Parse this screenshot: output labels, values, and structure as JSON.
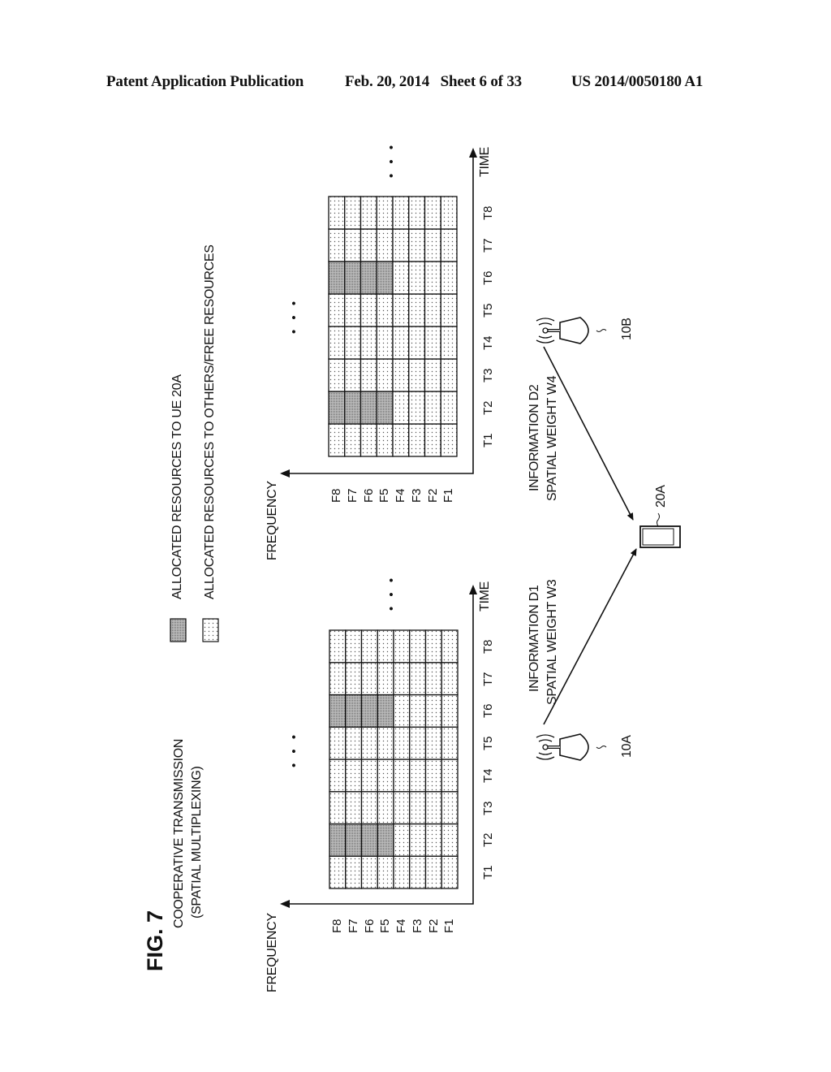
{
  "header": {
    "publication": "Patent Application Publication",
    "date_sheet": "Feb. 20, 2014   Sheet 6 of 33",
    "number": "US 2014/0050180 A1"
  },
  "figure": {
    "label": "FIG. 7",
    "title_line1": "COOPERATIVE TRANSMISSION",
    "title_line2": "(SPATIAL MULTIPLEXING)",
    "legend": [
      {
        "label": "ALLOCATED RESOURCES TO UE 20A",
        "pattern": "dense-shaded"
      },
      {
        "label": "ALLOCATED RESOURCES TO OTHERS/FREE RESOURCES",
        "pattern": "sparse-dotted"
      }
    ],
    "grids": [
      {
        "name": "grid-base-station-10A",
        "x_axis_label": "TIME",
        "y_axis_label": "FREQUENCY",
        "time_labels": [
          "T1",
          "T2",
          "T3",
          "T4",
          "T5",
          "T6",
          "T7",
          "T8"
        ],
        "freq_labels": [
          "F8",
          "F7",
          "F6",
          "F5",
          "F4",
          "F3",
          "F2",
          "F1"
        ],
        "allocated_to_ue": [
          {
            "time": "T2",
            "freqs": [
              "F8",
              "F7",
              "F6",
              "F5"
            ]
          },
          {
            "time": "T6",
            "freqs": [
              "F8",
              "F7",
              "F6",
              "F5"
            ]
          }
        ],
        "ellipsis": "• • •"
      },
      {
        "name": "grid-base-station-10B",
        "x_axis_label": "TIME",
        "y_axis_label": "FREQUENCY",
        "time_labels": [
          "T1",
          "T2",
          "T3",
          "T4",
          "T5",
          "T6",
          "T7",
          "T8"
        ],
        "freq_labels": [
          "F8",
          "F7",
          "F6",
          "F5",
          "F4",
          "F3",
          "F2",
          "F1"
        ],
        "allocated_to_ue": [
          {
            "time": "T2",
            "freqs": [
              "F8",
              "F7",
              "F6",
              "F5"
            ]
          },
          {
            "time": "T6",
            "freqs": [
              "F8",
              "F7",
              "F6",
              "F5"
            ]
          }
        ],
        "ellipsis": "• • •"
      }
    ],
    "stations": [
      {
        "id": "10A",
        "info_line1": "INFORMATION D1",
        "info_line2": "SPATIAL WEIGHT W3"
      },
      {
        "id": "10B",
        "info_line1": "INFORMATION D2",
        "info_line2": "SPATIAL WEIGHT W4"
      }
    ],
    "ue": {
      "id": "20A"
    }
  }
}
